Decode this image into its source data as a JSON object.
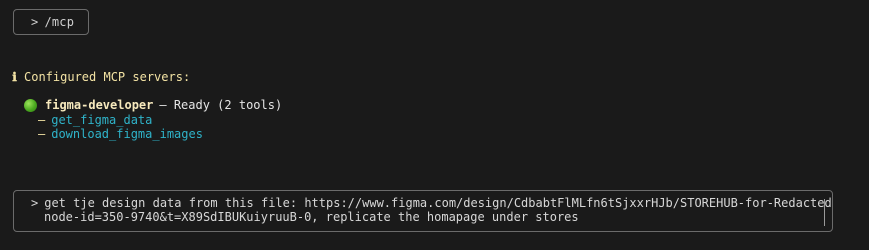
{
  "command": {
    "prompt": ">",
    "text": "/mcp"
  },
  "info": {
    "icon": "info-icon",
    "icon_glyph": "ℹ",
    "text": "Configured MCP servers:"
  },
  "servers": [
    {
      "status_color": "#4aa81f",
      "name": "figma-developer",
      "status": "– Ready (2 tools)",
      "tools": [
        {
          "bullet": "–",
          "name": "get_figma_data"
        },
        {
          "bullet": "–",
          "name": "download_figma_images"
        }
      ]
    }
  ],
  "input": {
    "prompt": ">",
    "line1": "get tje design data from this file: https://www.figma.com/design/CdbabtFlMLfn6tSjxxrHJb/STOREHUB-for-Redacted?",
    "line2": "node-id=350-9740&t=X89SdIBUKuiyruuB-0, replicate the homapage under stores"
  },
  "colors": {
    "background": "#1a1a1a",
    "info_text": "#f3e3a4",
    "tool_link": "#2fb3c9",
    "border": "#6b6b6b"
  }
}
